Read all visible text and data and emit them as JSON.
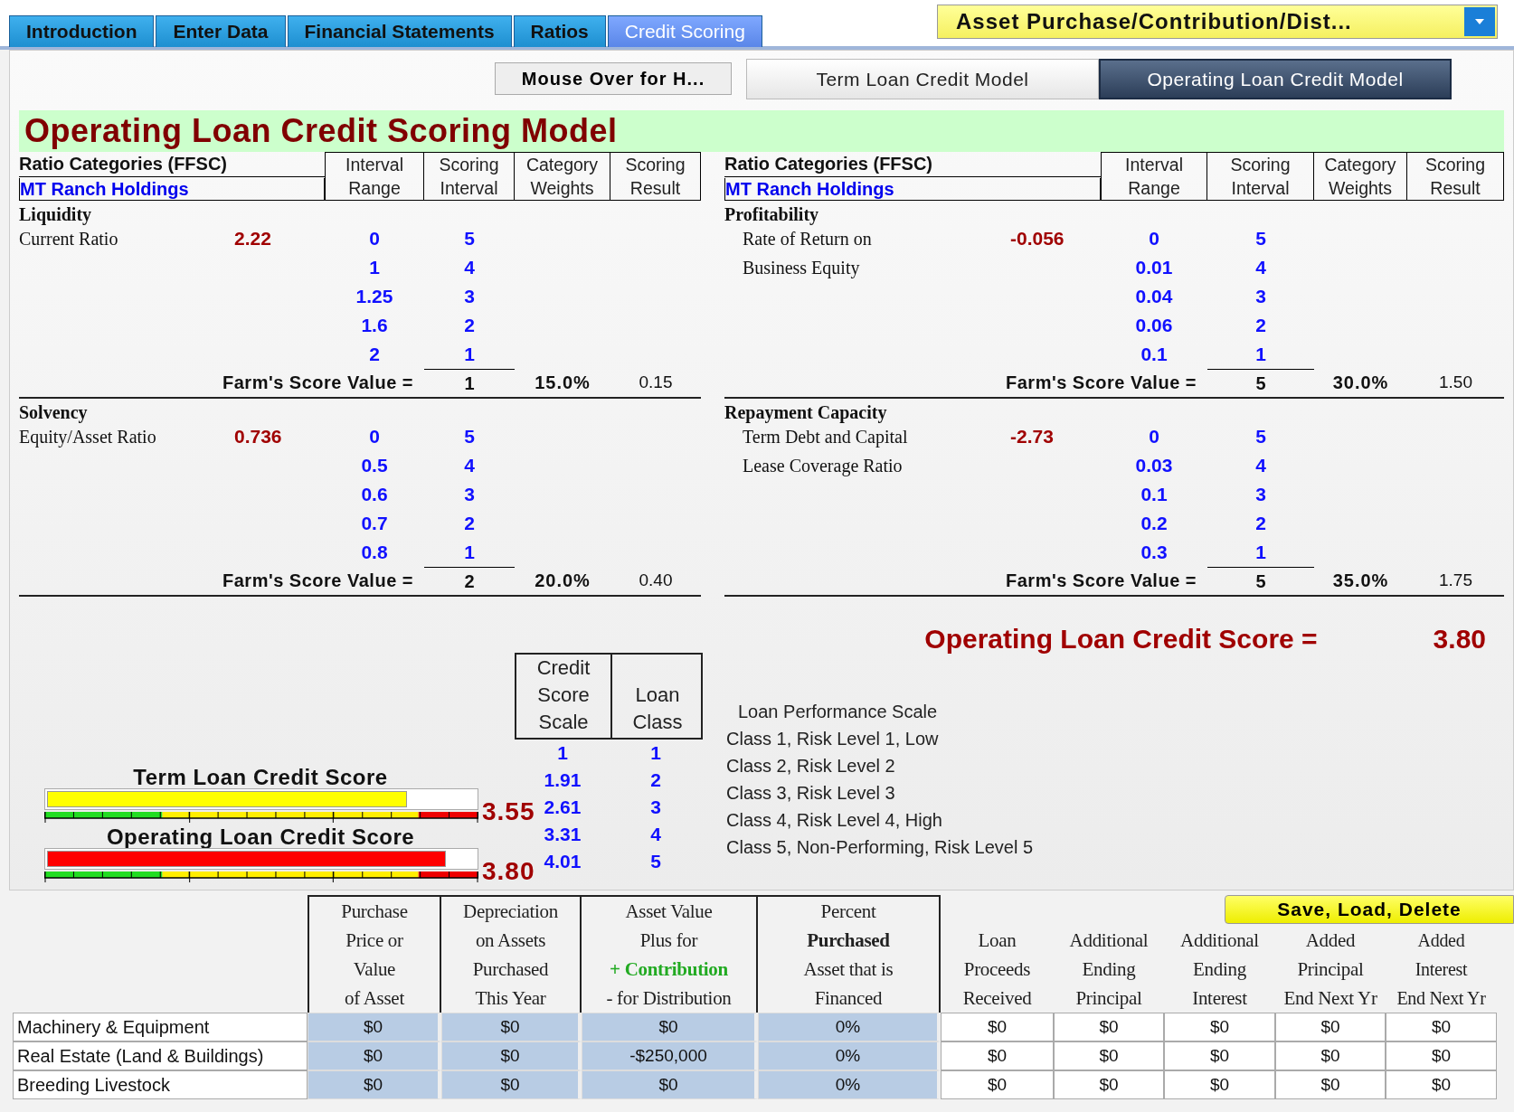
{
  "tabs": [
    {
      "label": "Introduction",
      "selected": false
    },
    {
      "label": "Enter Data",
      "selected": false
    },
    {
      "label": "Financial Statements",
      "selected": false
    },
    {
      "label": "Ratios",
      "selected": false
    },
    {
      "label": "Credit Scoring",
      "selected": true
    }
  ],
  "asset_dropdown": {
    "label": "Asset Purchase/Contribution/Dist..."
  },
  "help_button": "Mouse Over for H...",
  "model_buttons": [
    {
      "label": "Term Loan Credit Model",
      "selected": false
    },
    {
      "label": "Operating Loan Credit Model",
      "selected": true
    }
  ],
  "title": "Operating Loan Credit Scoring Model",
  "panels": [
    {
      "category_label": "Ratio Categories (FFSC)",
      "entity": "MT Ranch Holdings",
      "columns": [
        "Interval\nRange",
        "Scoring\nInterval",
        "Category\nWeights",
        "Scoring\nResult"
      ],
      "sections": [
        {
          "name": "Liquidity",
          "ratio_lines": [
            "Current Ratio"
          ],
          "ratio_value": "2.22",
          "intervals": [
            {
              "range": "0",
              "score": "5"
            },
            {
              "range": "1",
              "score": "4"
            },
            {
              "range": "1.25",
              "score": "3"
            },
            {
              "range": "1.6",
              "score": "2"
            },
            {
              "range": "2",
              "score": "1"
            }
          ],
          "score_label": "Farm's Score Value =",
          "score": "1",
          "weight": "15.0%",
          "result": "0.15"
        },
        {
          "name": "Solvency",
          "ratio_lines": [
            "Equity/Asset Ratio"
          ],
          "ratio_value": "0.736",
          "intervals": [
            {
              "range": "0",
              "score": "5"
            },
            {
              "range": "0.5",
              "score": "4"
            },
            {
              "range": "0.6",
              "score": "3"
            },
            {
              "range": "0.7",
              "score": "2"
            },
            {
              "range": "0.8",
              "score": "1"
            }
          ],
          "score_label": "Farm's Score Value =",
          "score": "2",
          "weight": "20.0%",
          "result": "0.40"
        }
      ]
    },
    {
      "category_label": "Ratio Categories (FFSC)",
      "entity": "MT Ranch Holdings",
      "columns": [
        "Interval\nRange",
        "Scoring\nInterval",
        "Category\nWeights",
        "Scoring\nResult"
      ],
      "sections": [
        {
          "name": "Profitability",
          "ratio_lines": [
            "Rate of Return on",
            "Business Equity"
          ],
          "ratio_value": "-0.056",
          "intervals": [
            {
              "range": "0",
              "score": "5"
            },
            {
              "range": "0.01",
              "score": "4"
            },
            {
              "range": "0.04",
              "score": "3"
            },
            {
              "range": "0.06",
              "score": "2"
            },
            {
              "range": "0.1",
              "score": "1"
            }
          ],
          "score_label": "Farm's Score Value =",
          "score": "5",
          "weight": "30.0%",
          "result": "1.50"
        },
        {
          "name": "Repayment Capacity",
          "ratio_lines": [
            "Term Debt and Capital",
            "Lease Coverage Ratio"
          ],
          "ratio_value": "-2.73",
          "intervals": [
            {
              "range": "0",
              "score": "5"
            },
            {
              "range": "0.03",
              "score": "4"
            },
            {
              "range": "0.1",
              "score": "3"
            },
            {
              "range": "0.2",
              "score": "2"
            },
            {
              "range": "0.3",
              "score": "1"
            }
          ],
          "score_label": "Farm's Score Value =",
          "score": "5",
          "weight": "35.0%",
          "result": "1.75"
        }
      ]
    }
  ],
  "credit_score": {
    "label": "Operating Loan Credit Score =",
    "value": "3.80"
  },
  "gauges": [
    {
      "label": "Term Loan Credit Score",
      "value": "3.55",
      "level": 0.84,
      "color": "#ffff00"
    },
    {
      "label": "Operating Loan Credit Score",
      "value": "3.80",
      "level": 0.93,
      "color": "#ff0000"
    }
  ],
  "scale_table": {
    "columns": [
      "Credit\nScore\nScale",
      "Loan\nClass"
    ],
    "rows": [
      {
        "score": "1",
        "class": "1"
      },
      {
        "score": "1.91",
        "class": "2"
      },
      {
        "score": "2.61",
        "class": "3"
      },
      {
        "score": "3.31",
        "class": "4"
      },
      {
        "score": "4.01",
        "class": "5"
      }
    ]
  },
  "loan_performance": {
    "heading": "Loan Performance Scale",
    "classes": [
      "Class 1, Risk Level 1,  Low",
      "Class 2, Risk Level 2",
      "Class 3, Risk Level 3",
      "Class 4, Risk Level 4,  High",
      "Class 5, Non-Performing, Risk Level 5"
    ]
  },
  "save_button": "Save, Load, Delete",
  "asset_table": {
    "columns": [
      {
        "input": true,
        "lines": [
          {
            "text": "Purchase",
            "kind": "plain"
          },
          {
            "text": "Price or",
            "kind": "plain"
          },
          {
            "text": "Value",
            "kind": "plain"
          },
          {
            "text": "of Asset",
            "kind": "plain"
          }
        ]
      },
      {
        "input": true,
        "lines": [
          {
            "text": "Depreciation",
            "kind": "plain"
          },
          {
            "text": "on Assets",
            "kind": "plain"
          },
          {
            "text": "Purchased",
            "kind": "plain"
          },
          {
            "text": "This Year",
            "kind": "plain"
          }
        ]
      },
      {
        "input": true,
        "lines": [
          {
            "text": "Asset Value",
            "kind": "plain"
          },
          {
            "text": "Plus for",
            "kind": "plain"
          },
          {
            "text": "+ Contribution",
            "kind": "green"
          },
          {
            "text": "- for Distribution",
            "kind": "plain"
          }
        ]
      },
      {
        "input": true,
        "lines": [
          {
            "text": "Percent",
            "kind": "plain"
          },
          {
            "text": "Purchased",
            "kind": "bold"
          },
          {
            "text": "Asset that is",
            "kind": "plain"
          },
          {
            "text": "Financed",
            "kind": "plain"
          }
        ]
      },
      {
        "input": false,
        "lines": [
          {
            "text": "Loan",
            "kind": "plain"
          },
          {
            "text": "Proceeds",
            "kind": "plain"
          },
          {
            "text": "Received",
            "kind": "plain"
          }
        ]
      },
      {
        "input": false,
        "lines": [
          {
            "text": "Additional",
            "kind": "plain"
          },
          {
            "text": "Ending",
            "kind": "plain"
          },
          {
            "text": "Principal",
            "kind": "plain"
          }
        ]
      },
      {
        "input": false,
        "lines": [
          {
            "text": "Additional",
            "kind": "plain"
          },
          {
            "text": "Ending",
            "kind": "plain"
          },
          {
            "text": "Interest",
            "kind": "plain"
          }
        ]
      },
      {
        "input": false,
        "lines": [
          {
            "text": "Added",
            "kind": "plain"
          },
          {
            "text": "Principal",
            "kind": "plain"
          },
          {
            "text": "End Next Yr",
            "kind": "plain"
          }
        ]
      },
      {
        "input": false,
        "lines": [
          {
            "text": "Added",
            "kind": "plain"
          },
          {
            "text": "Interest",
            "kind": "plain"
          },
          {
            "text": "End Next Yr",
            "kind": "plain"
          }
        ]
      }
    ],
    "rows": [
      {
        "label": "Machinery & Equipment",
        "cells": [
          "$0",
          "$0",
          "$0",
          "0%",
          "$0",
          "$0",
          "$0",
          "$0",
          "$0"
        ]
      },
      {
        "label": "Real Estate (Land & Buildings)",
        "cells": [
          "$0",
          "$0",
          "-$250,000",
          "0%",
          "$0",
          "$0",
          "$0",
          "$0",
          "$0"
        ]
      },
      {
        "label": "Breeding Livestock",
        "cells": [
          "$0",
          "$0",
          "$0",
          "0%",
          "$0",
          "$0",
          "$0",
          "$0",
          "$0"
        ]
      }
    ]
  }
}
